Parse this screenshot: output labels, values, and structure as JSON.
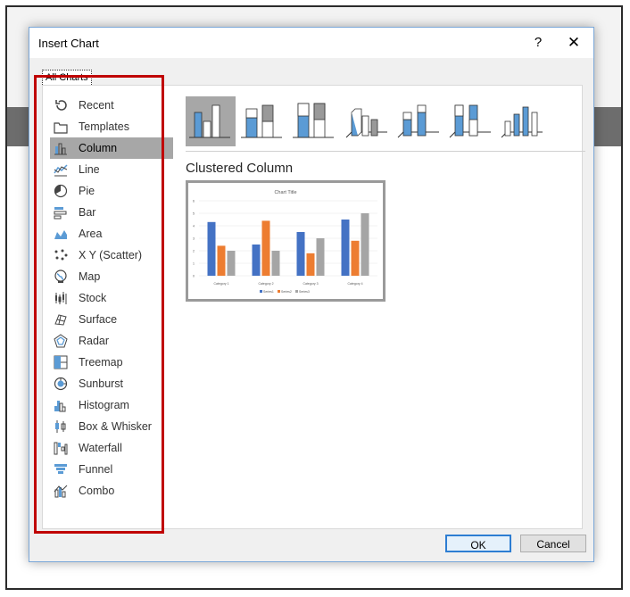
{
  "dialog": {
    "title": "Insert Chart",
    "help_glyph": "?",
    "close_glyph": "✕",
    "tab_label": "All Charts",
    "selected_subtype_name": "Clustered Column",
    "ok_label": "OK",
    "cancel_label": "Cancel"
  },
  "categories": [
    {
      "label": "Recent",
      "icon": "recent-icon"
    },
    {
      "label": "Templates",
      "icon": "templates-icon"
    },
    {
      "label": "Column",
      "icon": "column-chart-icon",
      "selected": true
    },
    {
      "label": "Line",
      "icon": "line-chart-icon"
    },
    {
      "label": "Pie",
      "icon": "pie-chart-icon"
    },
    {
      "label": "Bar",
      "icon": "bar-chart-icon"
    },
    {
      "label": "Area",
      "icon": "area-chart-icon"
    },
    {
      "label": "X Y (Scatter)",
      "icon": "scatter-chart-icon"
    },
    {
      "label": "Map",
      "icon": "map-chart-icon"
    },
    {
      "label": "Stock",
      "icon": "stock-chart-icon"
    },
    {
      "label": "Surface",
      "icon": "surface-chart-icon"
    },
    {
      "label": "Radar",
      "icon": "radar-chart-icon"
    },
    {
      "label": "Treemap",
      "icon": "treemap-chart-icon"
    },
    {
      "label": "Sunburst",
      "icon": "sunburst-chart-icon"
    },
    {
      "label": "Histogram",
      "icon": "histogram-chart-icon"
    },
    {
      "label": "Box & Whisker",
      "icon": "box-whisker-chart-icon"
    },
    {
      "label": "Waterfall",
      "icon": "waterfall-chart-icon"
    },
    {
      "label": "Funnel",
      "icon": "funnel-chart-icon"
    },
    {
      "label": "Combo",
      "icon": "combo-chart-icon"
    }
  ],
  "subtypes": [
    {
      "icon": "clustered-column-icon",
      "selected": true
    },
    {
      "icon": "stacked-column-icon"
    },
    {
      "icon": "100-stacked-column-icon"
    },
    {
      "icon": "3d-clustered-column-icon"
    },
    {
      "icon": "3d-stacked-column-icon"
    },
    {
      "icon": "3d-100-stacked-column-icon"
    },
    {
      "icon": "3d-column-icon"
    }
  ],
  "preview": {
    "title": "Chart Title",
    "categories": [
      "Category 1",
      "Category 2",
      "Category 3",
      "Category 4"
    ],
    "yticks": [
      "0",
      "1",
      "2",
      "3",
      "4",
      "5",
      "6"
    ],
    "series": [
      {
        "name": "Series1",
        "color": "#4472c4",
        "values": [
          4.3,
          2.5,
          3.5,
          4.5
        ]
      },
      {
        "name": "Series2",
        "color": "#ed7d31",
        "values": [
          2.4,
          4.4,
          1.8,
          2.8
        ]
      },
      {
        "name": "Series3",
        "color": "#a5a5a5",
        "values": [
          2,
          2,
          3,
          5
        ]
      }
    ],
    "ymax": 6
  },
  "colors": {
    "highlight": "#c00000",
    "selection": "#a7a7a7",
    "icon_blue": "#5b9bd5"
  }
}
